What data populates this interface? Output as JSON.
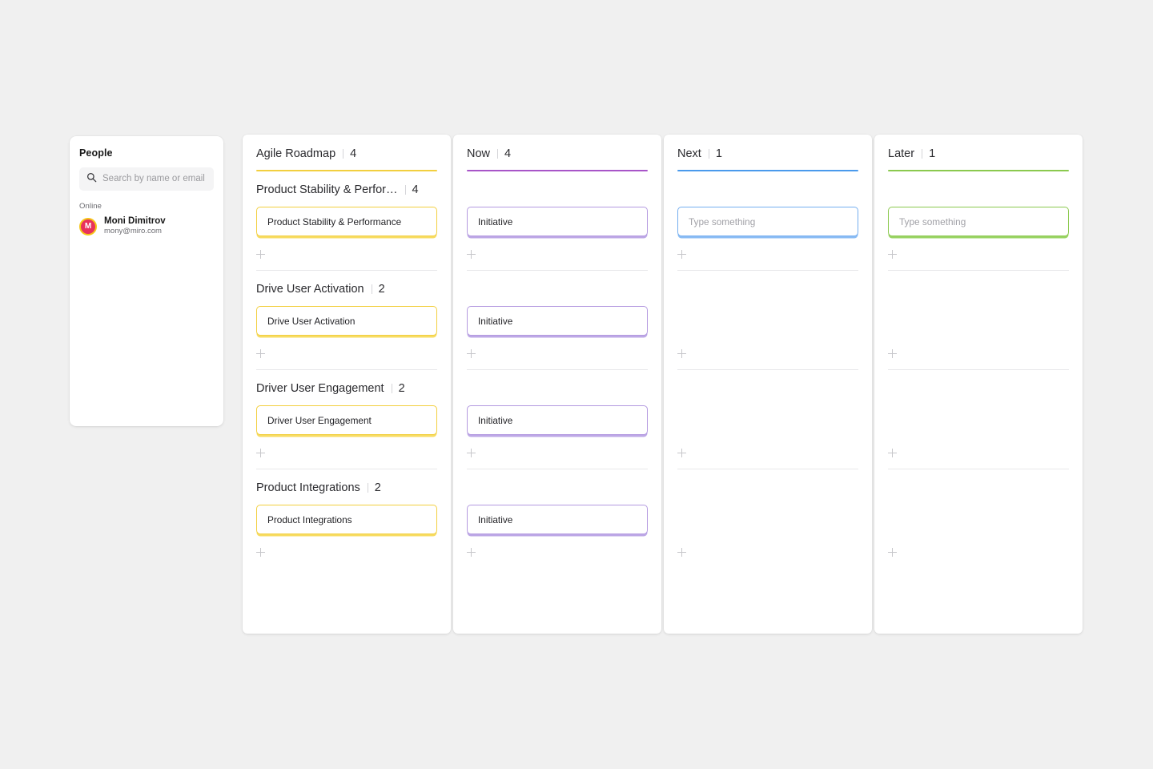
{
  "people": {
    "title": "People",
    "search": {
      "placeholder": "Search by name or email",
      "value": ""
    },
    "status_label": "Online",
    "members": [
      {
        "initial": "M",
        "name": "Moni Dimitrov",
        "email": "mony@miro.com"
      }
    ]
  },
  "board": {
    "columns": [
      {
        "title": "Agile Roadmap",
        "count": "4",
        "accent": "#f2cf3f",
        "card_style": "yellow",
        "sections": [
          {
            "title": "Product Stability & Perfor…",
            "count": "4",
            "card": {
              "text": "Product Stability & Performance",
              "is_placeholder": false
            }
          },
          {
            "title": "Drive User Activation",
            "count": "2",
            "card": {
              "text": "Drive User Activation",
              "is_placeholder": false
            }
          },
          {
            "title": "Driver User Engagement",
            "count": "2",
            "card": {
              "text": "Driver User Engagement",
              "is_placeholder": false
            }
          },
          {
            "title": "Product Integrations",
            "count": "2",
            "card": {
              "text": "Product Integrations",
              "is_placeholder": false
            }
          }
        ]
      },
      {
        "title": "Now",
        "count": "4",
        "accent": "#a855c8",
        "card_style": "purple",
        "sections": [
          {
            "title": "",
            "count": "",
            "card": {
              "text": "Initiative",
              "is_placeholder": false
            }
          },
          {
            "title": "",
            "count": "",
            "card": {
              "text": "Initiative",
              "is_placeholder": false
            }
          },
          {
            "title": "",
            "count": "",
            "card": {
              "text": "Initiative",
              "is_placeholder": false
            }
          },
          {
            "title": "",
            "count": "",
            "card": {
              "text": "Initiative",
              "is_placeholder": false
            }
          }
        ]
      },
      {
        "title": "Next",
        "count": "1",
        "accent": "#4a9aec",
        "card_style": "blue",
        "sections": [
          {
            "title": "",
            "count": "",
            "card": {
              "text": "Type something",
              "is_placeholder": true
            }
          },
          {
            "title": "",
            "count": "",
            "card": null
          },
          {
            "title": "",
            "count": "",
            "card": null
          },
          {
            "title": "",
            "count": "",
            "card": null
          }
        ]
      },
      {
        "title": "Later",
        "count": "1",
        "accent": "#8bc94e",
        "card_style": "green",
        "sections": [
          {
            "title": "",
            "count": "",
            "card": {
              "text": "Type something",
              "is_placeholder": true
            }
          },
          {
            "title": "",
            "count": "",
            "card": null
          },
          {
            "title": "",
            "count": "",
            "card": null
          },
          {
            "title": "",
            "count": "",
            "card": null
          }
        ]
      }
    ]
  },
  "icons": {
    "search": "search-icon",
    "add": "plus-icon"
  }
}
